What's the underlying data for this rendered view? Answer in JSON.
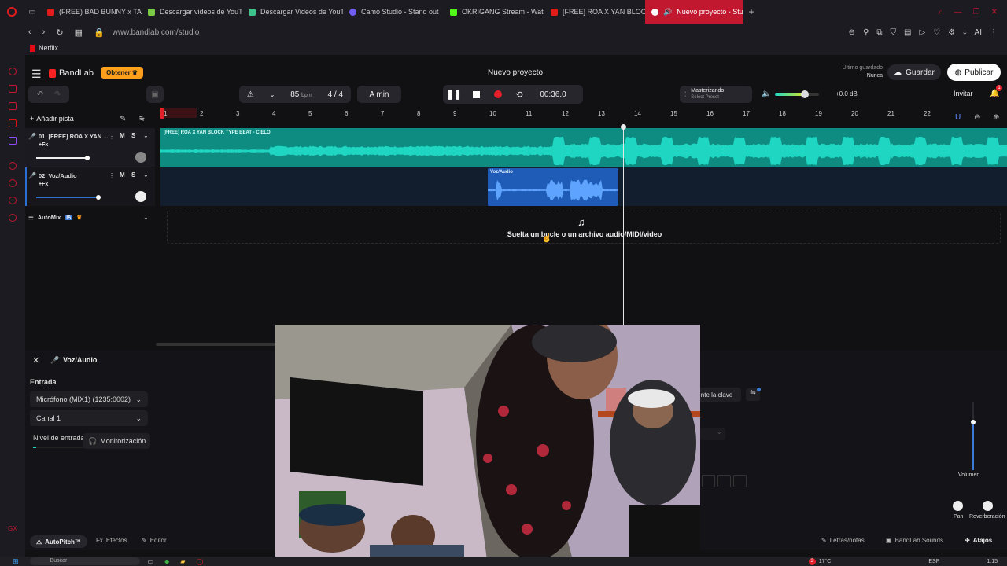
{
  "browser": {
    "tabs": [
      {
        "label": "(FREE) BAD BUNNY x TAI",
        "color": "#e21b1b"
      },
      {
        "label": "Descargar videos de YouT",
        "color": "#7ac943"
      },
      {
        "label": "Descargar Videos de YouT",
        "color": "#3ec18b"
      },
      {
        "label": "Camo Studio - Stand out",
        "color": "#6f5cf6"
      },
      {
        "label": "OKRIGANG Stream - Wate",
        "color": "#53fc18"
      },
      {
        "label": "[FREE] ROA X YAN BLOCK",
        "color": "#e21b1b"
      },
      {
        "label": "Nuevo proyecto - Studi",
        "color": "#ffffff"
      }
    ],
    "url": "www.bandlab.com/studio",
    "bookmark": "Netflix"
  },
  "header": {
    "brand": "BandLab",
    "get_label": "Obtener",
    "project_title": "Nuevo proyecto",
    "last_saved_label": "Último guardado",
    "last_saved_value": "Nunca",
    "save_label": "Guardar",
    "publish_label": "Publicar"
  },
  "transport": {
    "bpm": "85",
    "bpm_unit": "bpm",
    "time_signature": "4 / 4",
    "key": "A min",
    "time": "00:36.0",
    "mastering_label": "Masterizando",
    "mastering_sub": "Select Preset",
    "master_db": "+0.0 dB",
    "invite_label": "Invitar",
    "notif_count": "1"
  },
  "ruler": [
    "1",
    "2",
    "3",
    "4",
    "5",
    "6",
    "7",
    "8",
    "9",
    "10",
    "11",
    "12",
    "13",
    "14",
    "15",
    "16",
    "17",
    "18",
    "19",
    "20",
    "21",
    "22"
  ],
  "tracks": {
    "add_label": "Añadir pista",
    "items": [
      {
        "num": "01",
        "name": "[FREE] ROA X YAN ...",
        "fx": "+Fx",
        "m": "M",
        "s": "S",
        "clip": "[FREE] ROA X YAN BLOCK TYPE BEAT - CIELO"
      },
      {
        "num": "02",
        "name": "Voz/Audio",
        "fx": "+Fx",
        "m": "M",
        "s": "S",
        "clip": "Voz/Audio"
      }
    ],
    "automix": "AutoMix",
    "automix_badge": "IA",
    "drop_hint": "Suelta un bucle o un archivo audio/MIDI/video"
  },
  "panel": {
    "track_name": "Voz/Audio",
    "input_label": "Entrada",
    "mic": "Micrófono (MIX1) (1235:0002)",
    "channel": "Canal 1",
    "level_label": "Nivel de entrada",
    "monitor_label": "Monitorización",
    "key_label": "nte la clave",
    "volume_label": "Volumen",
    "pan_label": "Pan",
    "reverb_label": "Reverberación"
  },
  "footer": {
    "autopitch": "AutoPitch™",
    "effects": "Efectos",
    "editor": "Editor",
    "lyrics": "Letras/notas",
    "sounds": "BandLab Sounds",
    "shortcuts": "Atajos"
  },
  "taskbar": {
    "search": "Buscar",
    "weather": "17°C",
    "lang": "ESP",
    "clock": "1:15",
    "badge": "3"
  },
  "colors": {
    "accent": "#c1172f",
    "wave": "#1fd6c3",
    "vocal": "#2a6fd6",
    "bg": "#111114"
  }
}
